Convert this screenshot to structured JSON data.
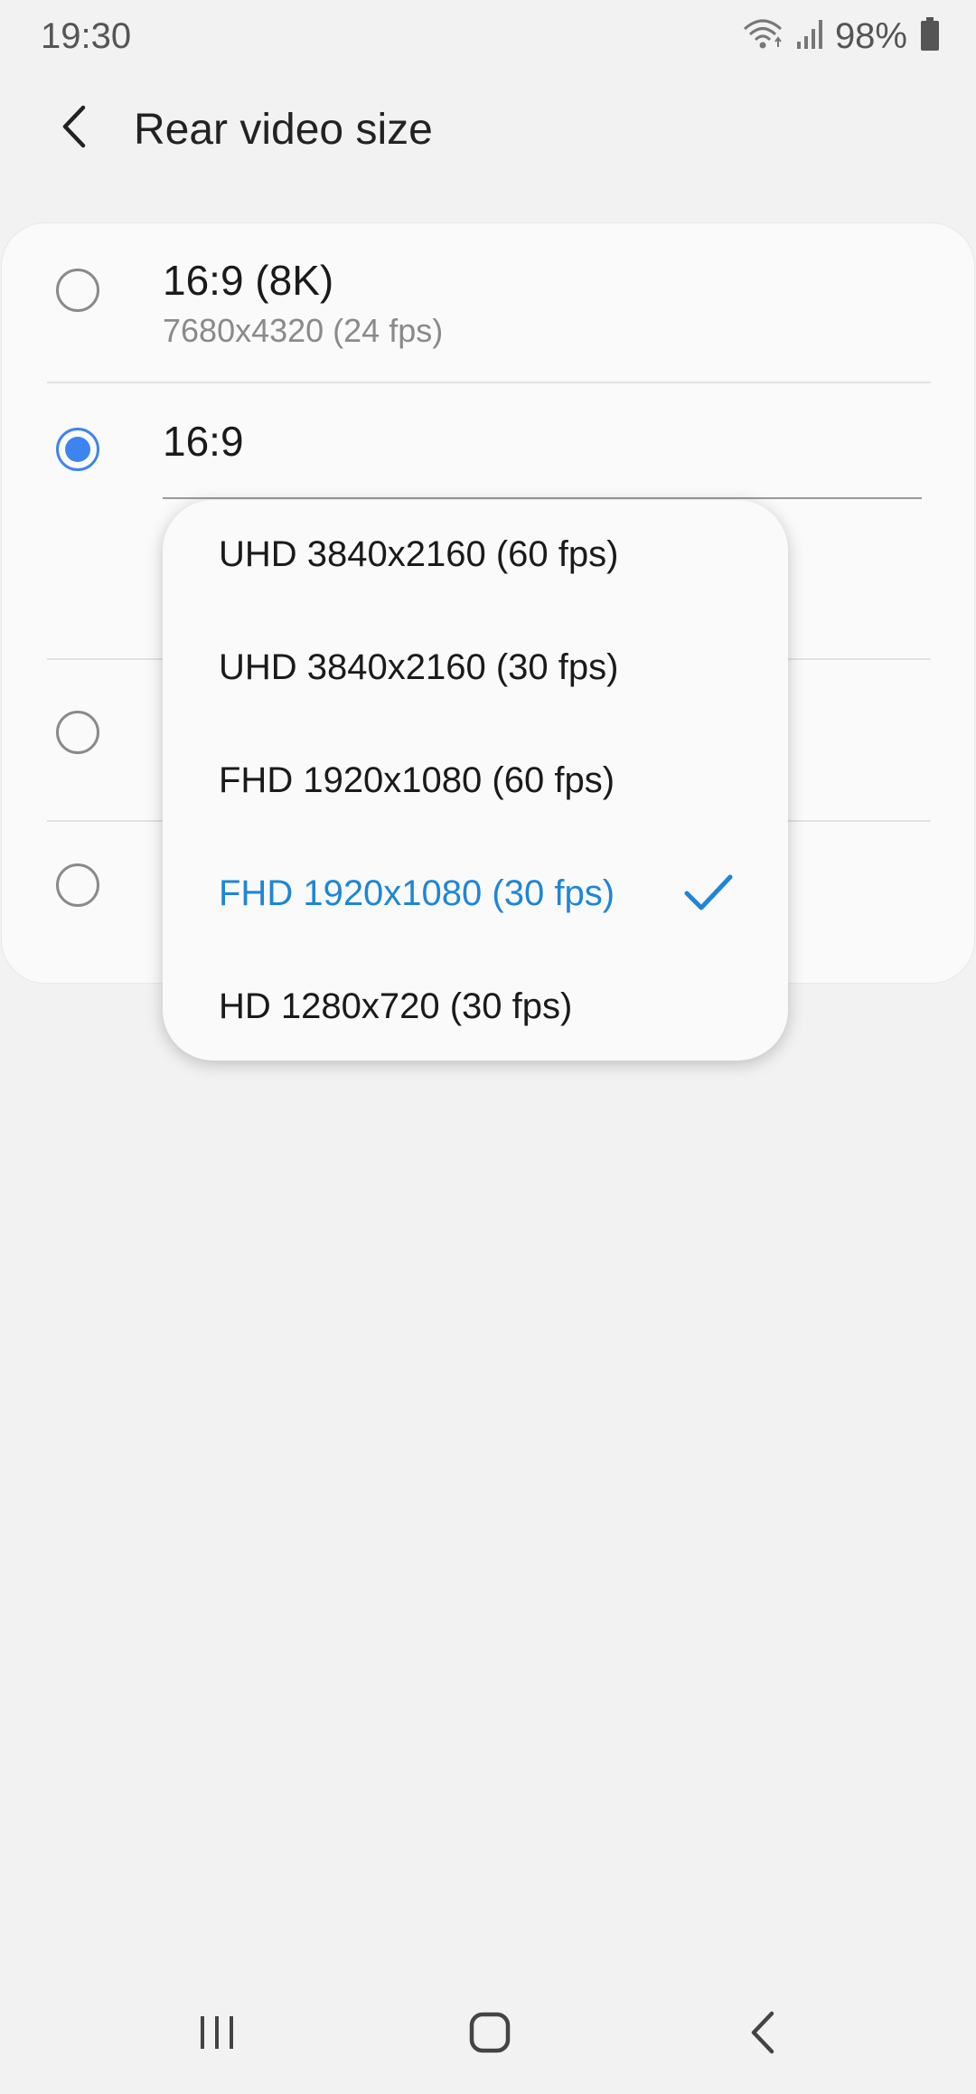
{
  "status_bar": {
    "time": "19:30",
    "battery_text": "98%",
    "icons": [
      "wifi-icon",
      "signal-icon",
      "battery-icon"
    ]
  },
  "header": {
    "title": "Rear video size",
    "back_icon": "chevron-left-icon"
  },
  "options": [
    {
      "title": "16:9 (8K)",
      "subtitle": "7680x4320 (24 fps)",
      "selected": false
    },
    {
      "title": "16:9",
      "selected": true
    },
    {
      "selected": false
    },
    {
      "selected": false
    }
  ],
  "dropdown": {
    "items": [
      {
        "label": "UHD 3840x2160 (60 fps)",
        "selected": false
      },
      {
        "label": "UHD 3840x2160 (30 fps)",
        "selected": false
      },
      {
        "label": "FHD 1920x1080 (60 fps)",
        "selected": false
      },
      {
        "label": "FHD 1920x1080 (30 fps)",
        "selected": true
      },
      {
        "label": "HD 1280x720 (30 fps)",
        "selected": false
      }
    ],
    "selected_color": "#1f86d6",
    "check_icon": "check-icon"
  },
  "colors": {
    "background": "#f2f2f2",
    "card": "#fafafa",
    "radio_accent": "#3e84f0"
  },
  "nav_bar": {
    "icons": [
      "recent-apps-icon",
      "home-icon",
      "back-icon"
    ]
  }
}
